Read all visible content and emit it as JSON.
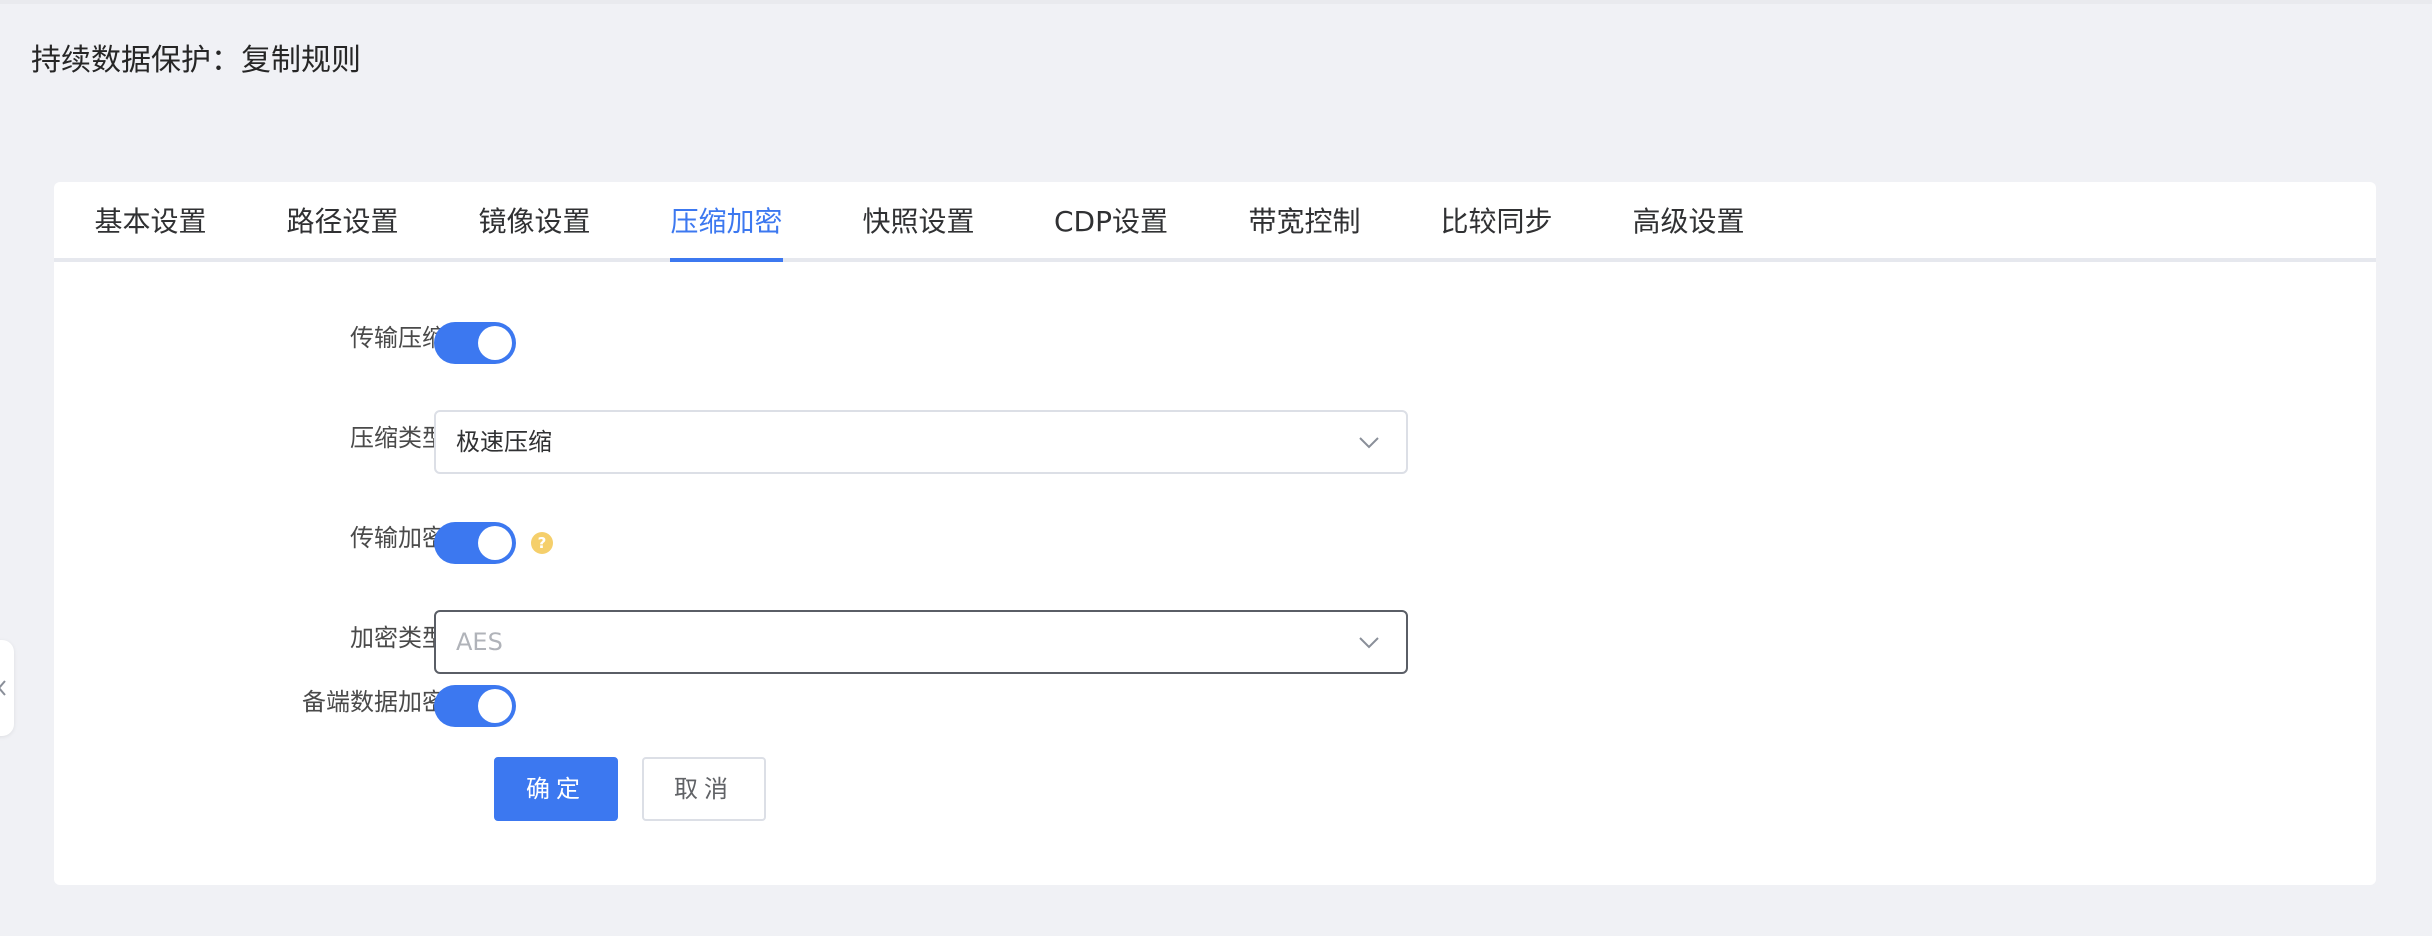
{
  "page": {
    "title": "持续数据保护：复制规则"
  },
  "tabs": [
    {
      "label": "基本设置"
    },
    {
      "label": "路径设置"
    },
    {
      "label": "镜像设置"
    },
    {
      "label": "压缩加密",
      "active": true
    },
    {
      "label": "快照设置"
    },
    {
      "label": "CDP设置"
    },
    {
      "label": "带宽控制"
    },
    {
      "label": "比较同步"
    },
    {
      "label": "高级设置"
    }
  ],
  "form": {
    "transfer_compression": {
      "label": "传输压缩",
      "enabled": true
    },
    "compression_type": {
      "label": "压缩类型",
      "value": "极速压缩"
    },
    "transfer_encryption": {
      "label": "传输加密",
      "enabled": true,
      "help_icon": "question-circle-icon"
    },
    "encryption_type": {
      "label": "加密类型",
      "placeholder": "AES"
    },
    "backup_data_encryption": {
      "label": "备端数据加密",
      "enabled": true
    }
  },
  "actions": {
    "confirm_label": "确定",
    "cancel_label": "取消"
  },
  "colors": {
    "primary": "#3c78f0",
    "background": "#f0f1f5",
    "help": "#f5cf6b"
  }
}
